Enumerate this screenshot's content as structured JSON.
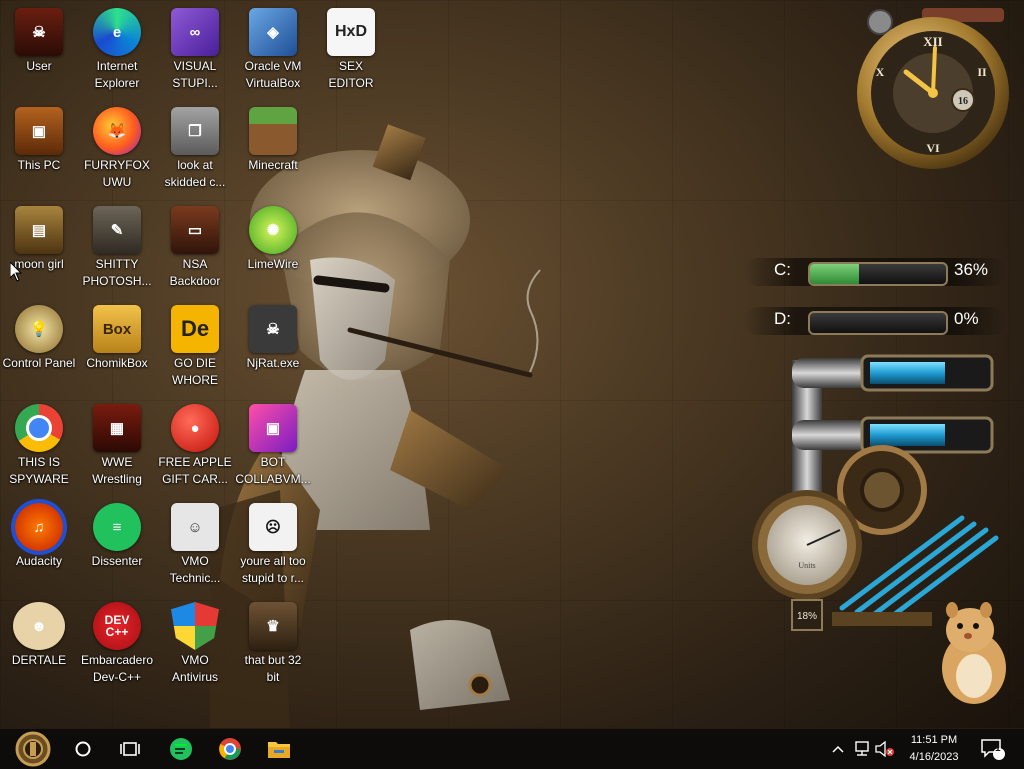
{
  "desktop": {
    "icons": [
      {
        "label": "User"
      },
      {
        "label": "Internet\nExplorer"
      },
      {
        "label": "VISUAL\nSTUPI..."
      },
      {
        "label": "Oracle VM\nVirtualBox"
      },
      {
        "label": "SEX\nEDITOR"
      },
      {
        "label": "This PC"
      },
      {
        "label": "FURRYFOX\nUWU"
      },
      {
        "label": "look at\nskidded c..."
      },
      {
        "label": "Minecraft"
      },
      {
        "label": "moon girl"
      },
      {
        "label": "SHITTY\nPHOTOSH..."
      },
      {
        "label": "NSA\nBackdoor"
      },
      {
        "label": "LimeWire"
      },
      {
        "label": "Control Panel"
      },
      {
        "label": "ChomikBox"
      },
      {
        "label": "GO DIE\nWHORE"
      },
      {
        "label": "NjRat.exe"
      },
      {
        "label": "THIS IS\nSPYWARE"
      },
      {
        "label": "WWE\nWrestling"
      },
      {
        "label": "FREE APPLE\nGIFT CAR..."
      },
      {
        "label": "BOT\nCOLLABVM..."
      },
      {
        "label": "Audacity"
      },
      {
        "label": "Dissenter"
      },
      {
        "label": "VMO\nTechnic..."
      },
      {
        "label": "youre all too\nstupid to r..."
      },
      {
        "label": "DERTALE"
      },
      {
        "label": "Embarcadero\nDev-C++"
      },
      {
        "label": "VMO\nAntivirus"
      },
      {
        "label": "that but 32\nbit"
      }
    ],
    "icon_texts": {
      "sex_editor": "HxD",
      "chomikbox": "Box",
      "go_die": "De",
      "devcpp": "DEV\nC++"
    }
  },
  "widgets": {
    "clock": {
      "numeral_top": "XII",
      "numeral_left": "X",
      "numeral_right": "II",
      "numeral_bottom": "VI",
      "day": "16"
    },
    "drives": [
      {
        "letter": "C:",
        "percent": "36%",
        "usage": 0.36
      },
      {
        "letter": "D:",
        "percent": "0%",
        "usage": 0.0
      }
    ],
    "gauge": {
      "reading": "18%",
      "caption": "Units"
    }
  },
  "taskbar": {
    "time": "11:51 PM",
    "date": "4/16/2023",
    "notification_count": "1",
    "pinned": [
      "cortana-icon",
      "task-view-icon",
      "dissenter-icon",
      "chrome-icon",
      "file-explorer-icon"
    ]
  },
  "colors": {
    "taskbar": "#0e0c0a",
    "drive_fill": "#3da145",
    "pipe_blue": "#2aa7d6"
  }
}
